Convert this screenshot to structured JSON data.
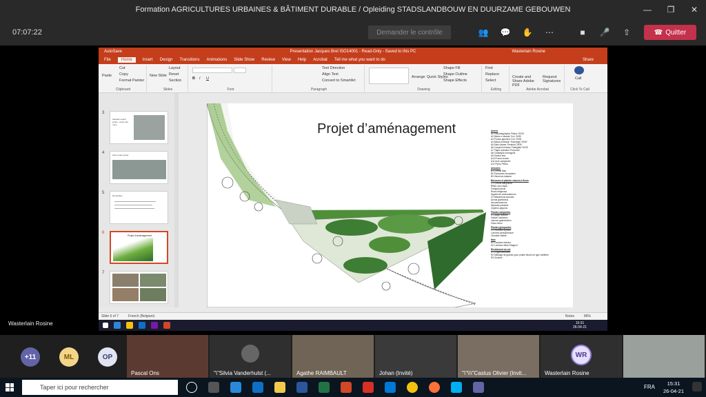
{
  "window": {
    "title": "Formation AGRICULTURES URBAINES & BÂTIMENT DURABLE / Opleiding STADSLANDBOUW EN DUURZAME GEBOUWEN"
  },
  "meeting": {
    "timer": "07:07:22",
    "request_control": "Demander le contrôle",
    "leave": "Quitter"
  },
  "ppt": {
    "title": "Presentation Jacques Brel ISO14001 - Read-Only - Saved to this PC",
    "user": "Wasterlain Rosine",
    "autosave": "AutoSave",
    "tabs": [
      "File",
      "Home",
      "Insert",
      "Design",
      "Transitions",
      "Animations",
      "Slide Show",
      "Review",
      "View",
      "Help",
      "Acrobat"
    ],
    "tell_me": "Tell me what you want to do",
    "share": "Share",
    "ribbon": {
      "clipboard": "Clipboard",
      "paste": "Paste",
      "cut": "Cut",
      "copy": "Copy",
      "format_painter": "Format Painter",
      "slides": "Slides",
      "new_slide": "New Slide",
      "layout": "Layout",
      "reset": "Reset",
      "section": "Section",
      "font": "Font",
      "paragraph": "Paragraph",
      "text_direction": "Text Direction",
      "align_text": "Align Text",
      "smartart": "Convert to SmartArt",
      "drawing": "Drawing",
      "arrange": "Arrange",
      "quick_styles": "Quick Styles",
      "shape_fill": "Shape Fill",
      "shape_outline": "Shape Outline",
      "shape_effects": "Shape Effects",
      "editing": "Editing",
      "find": "Find",
      "replace": "Replace",
      "select": "Select",
      "acrobat": "Adobe Acrobat",
      "create_share": "Create and Share Adobe PDF",
      "request_sig": "Request Signatures",
      "call_to_call": "Click To Call",
      "call": "Call"
    },
    "thumbs": [
      {
        "num": "3",
        "text": "Situation avant projet : sortie des murs"
      },
      {
        "num": "4",
        "text": "Zone avant projet"
      },
      {
        "num": "5",
        "text": "Demandes"
      },
      {
        "num": "6",
        "text": "Projet d'aménagement"
      },
      {
        "num": "7",
        "text": ""
      }
    ],
    "slide_title": "Projet d’aménagement",
    "status": {
      "slide": "Slide 6 of 7",
      "lang": "French (Belgium)",
      "notes": "Notes",
      "zoom": "86%"
    }
  },
  "legend": [
    {
      "head": "Arbres",
      "items": [
        "A1 Tilia platyphyllos 'Rubra' 20/25",
        "A2 Malus x robusta 'Cox' 20/30",
        "A3 Prunus japonica 'Cox' 20/30",
        "A4 Malus profusion 'Sumsingh' 25/30",
        "A5 Salix caprea 'Pendula' 25/30",
        "A6 Carpinus betulus 'Fastigiata' 20/25",
        "A7 Fagus sylvatica 'Purpurea'",
        "A8 Crataegus monogyna",
        "A9 Sorbus aria",
        "A10 Prunus avium",
        "A11 Acer campestre",
        "A12 Pyrus Pedus"
      ]
    },
    {
      "head": "Arbustes",
      "items": [
        "B1 Cornus Mas",
        "B2 Euonymus europaeus",
        "B3 Viburnum lantana"
      ]
    },
    {
      "head": "Buissons et plantes vivaces à fleurs",
      "items": [
        "C1 Cornus sanguinea",
        "Ribes uva-crispa",
        "Frangula alnus",
        "Rosa rubiginosa",
        "Hypericum androsaemum",
        "C2 Miscanthus sinensis",
        "Aronia gramineus",
        "Iris pseudacorus",
        "Myosotis palustris",
        "Cyperus papyrus"
      ]
    },
    {
      "head": "Plantes rampantes",
      "items": [
        "D1 Ajuga reptans",
        "Galium odoratum",
        "Lamium galeobdolon",
        "Vinca minor"
      ]
    },
    {
      "head": "Plantes grimpantes",
      "items": [
        "G1 Humulus lupulus",
        "Lonicera periclymenum",
        "Clematis vitalba"
      ]
    },
    {
      "head": "Haie",
      "items": [
        "H1 Carpinus betulus",
        "H2 Lonicera nitida 'Maigrun'"
      ]
    },
    {
      "head": "Revêtement du sol",
      "items": [
        "R1 Engazonnement",
        "R2 Mélange de graines pour prairie fleurie de type mellifère",
        "R3 Dolomie"
      ]
    }
  ],
  "presenter": "Wasterlain Rosine",
  "participants": {
    "avatars": [
      {
        "label": "+11",
        "color": "#6264a7"
      },
      {
        "label": "ML",
        "color": "#f3d58a"
      },
      {
        "label": "OP",
        "color": "#dfe3f2"
      }
    ],
    "tiles": [
      "Pascal Ons",
      "\"\\\"Silvia Vanderhulst (...",
      "Agathe RAIMBAULT",
      "Johan (Invité)",
      "\"\\\"\\\\\\\"Castus Olivier (Invit...",
      "Wasterlain Rosine",
      ""
    ],
    "wr": "WR"
  },
  "taskbar": {
    "search": "Taper ici pour rechercher",
    "lang": "FRA",
    "time": "15:31",
    "date": "26-04-21",
    "inner_time": "15:31",
    "inner_date": "26-04-21"
  }
}
